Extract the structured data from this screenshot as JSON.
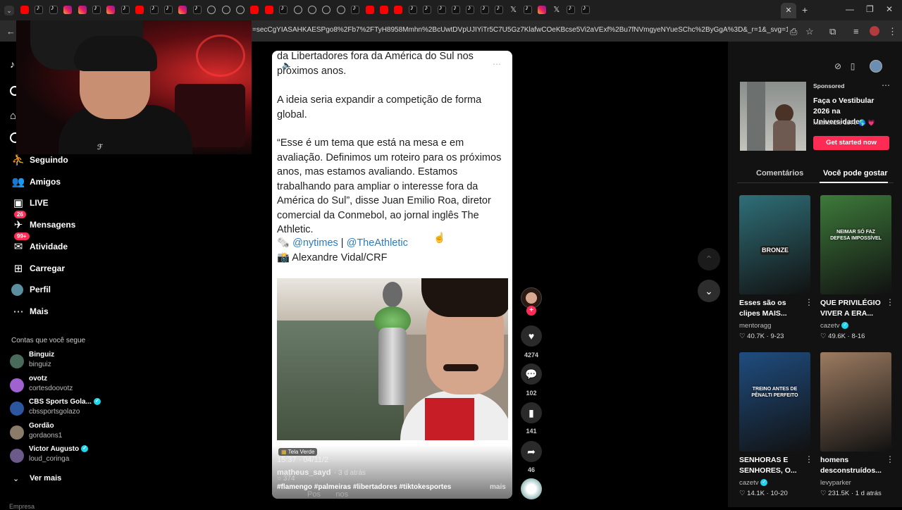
{
  "browser": {
    "url": "=secCgYIASAHKAESPgo8%2Fb7%2FTyH8958Mmhn%2BcUwtDVpUJIYiTr5C7U5Gz7KlafwCOeKBcse5Vi2aVExf%2Bu7fNVmgyeNYueSChc%2ByGgA%3D&_r=1&_svg=1&checksum=8874...",
    "tabs": [
      "yt",
      "tt",
      "tt",
      "ig",
      "ig",
      "tt",
      "ig",
      "tt",
      "yt",
      "tt",
      "tt",
      "ig",
      "tt",
      "gl",
      "gl",
      "gl",
      "yt",
      "yt",
      "tt",
      "gl",
      "gl",
      "gl",
      "gl",
      "tt",
      "yt",
      "yt",
      "yt",
      "tt",
      "tt",
      "tt",
      "tt",
      "tt",
      "tt",
      "tt",
      "x",
      "tt",
      "ig",
      "x",
      "tt",
      "tt"
    ]
  },
  "nav": {
    "items": [
      {
        "label": "Seguindo",
        "icon": "person-follow-icon"
      },
      {
        "label": "Amigos",
        "icon": "friends-icon"
      },
      {
        "label": "LIVE",
        "icon": "live-icon"
      },
      {
        "label": "Mensagens",
        "icon": "message-icon",
        "badge": "26"
      },
      {
        "label": "Atividade",
        "icon": "activity-icon",
        "badge": "99+"
      },
      {
        "label": "Carregar",
        "icon": "upload-icon"
      },
      {
        "label": "Perfil",
        "icon": "profile-icon"
      },
      {
        "label": "Mais",
        "icon": "more-icon"
      }
    ],
    "following_title": "Contas que você segue",
    "accounts": [
      {
        "name": "Binguiz",
        "handle": "binguiz",
        "verified": false,
        "color": "#4a6b5c"
      },
      {
        "name": "ovotz",
        "handle": "cortesdoovotz",
        "verified": false,
        "color": "#a061d1"
      },
      {
        "name": "CBS Sports Gola...",
        "handle": "cbssportsgolazo",
        "verified": true,
        "color": "#2d56a0"
      },
      {
        "name": "Gordão",
        "handle": "gordaons1",
        "verified": false,
        "color": "#8a7b6a"
      },
      {
        "name": "Victor Augusto",
        "handle": "loud_coringa",
        "verified": true,
        "color": "#6b5a8a"
      }
    ],
    "see_more": "Ver mais",
    "bottom_label": "Empresa"
  },
  "video": {
    "para1": "da Libertadores fora da América do Sul nos próximos anos.",
    "para2": "A ideia seria expandir a competição de forma global.",
    "para3": "“Esse é um tema que está na mesa e em avaliação. Definimos um roteiro para os próximos anos, mas estamos avaliando. Estamos trabalhando para ampliar o interesse fora da América do Sul”, disse Juan Emilio Roa, diretor comercial da Conmebol, ao jornal inglês The Athletic.",
    "source_link1": "@nytimes",
    "source_sep": " | ",
    "source_link2": "@TheAthletic",
    "photo_credit": "Alexandre Vidal/CRF",
    "effect_label": "Tela Verde",
    "time_overlay": "15:37 · 04/11/2",
    "author": "matheus_sayd",
    "posted": "· 3 d atrás",
    "hashtags": "#flamengo #palmeiras #libertadores #tiktokesportes",
    "more": "mais",
    "comment_preview_count": "374",
    "comment_preview_text": "Pos       nos"
  },
  "actions": {
    "likes": "4274",
    "comments": "102",
    "saves": "141",
    "shares": "46"
  },
  "right_panel": {
    "ad": {
      "sponsored": "Sponsored",
      "title": "Faça o Vestibular 2026 na Universidade...",
      "advertiser": "Mackenzie 1870 🌎 💗",
      "cta": "Get started now"
    },
    "tabs": [
      "Comentários",
      "Você pode gostar"
    ],
    "videos": [
      {
        "title": "Esses são os clipes MAIS...",
        "author": "mentoragg",
        "verified": false,
        "likes": "40.7K",
        "date": "9-23",
        "overlay": "BRONZE",
        "bg": "#2f6f78"
      },
      {
        "title": "QUE PRIVILÉGIO VIVER A ERA...",
        "author": "cazetv",
        "verified": true,
        "likes": "49.6K",
        "date": "8-16",
        "overlay": "NEIMAR SÓ FAZ DEFESA IMPOSSÍVEL",
        "bg": "#3d7a3a"
      },
      {
        "title": "SENHORAS E SENHORES, O...",
        "author": "cazetv",
        "verified": true,
        "likes": "14.1K",
        "date": "10-20",
        "overlay": "TREINO ANTES DE PÊNALTI PERFEITO",
        "bg": "#1f4d80"
      },
      {
        "title": "homens desconstruídos...",
        "author": "levyparker",
        "verified": false,
        "likes": "231.5K",
        "date": "1 d atrás",
        "overlay": "",
        "bg": "#9c7b61"
      }
    ]
  }
}
